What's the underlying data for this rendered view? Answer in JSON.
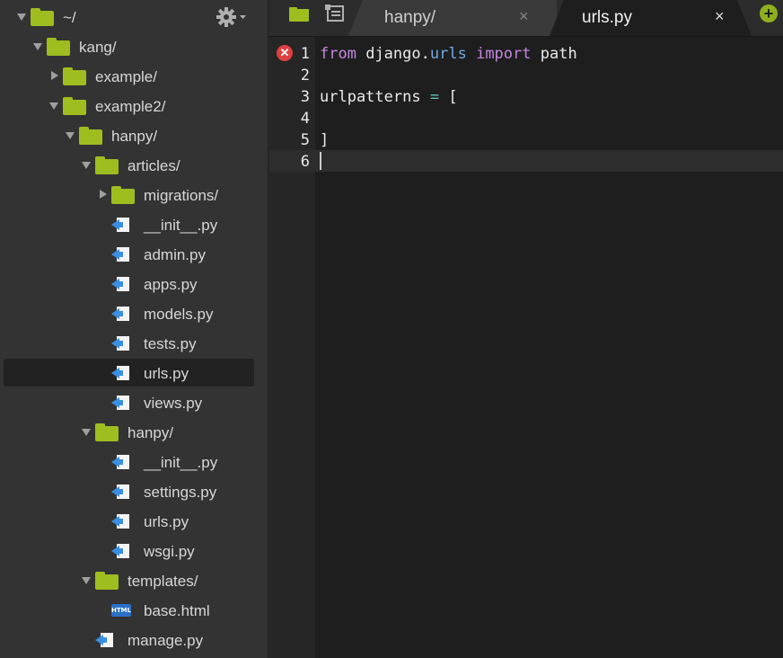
{
  "sidebar": {
    "root": "~/",
    "items": [
      {
        "label": "kang/",
        "type": "folder",
        "expanded": true,
        "depth": 1
      },
      {
        "label": "example/",
        "type": "folder",
        "expanded": false,
        "depth": 2
      },
      {
        "label": "example2/",
        "type": "folder",
        "expanded": true,
        "depth": 2
      },
      {
        "label": "hanpy/",
        "type": "folder",
        "expanded": true,
        "depth": 3
      },
      {
        "label": "articles/",
        "type": "folder",
        "expanded": true,
        "depth": 4
      },
      {
        "label": "migrations/",
        "type": "folder",
        "expanded": false,
        "depth": 5
      },
      {
        "label": "__init__.py",
        "type": "python",
        "depth": 5
      },
      {
        "label": "admin.py",
        "type": "python",
        "depth": 5
      },
      {
        "label": "apps.py",
        "type": "python",
        "depth": 5
      },
      {
        "label": "models.py",
        "type": "python",
        "depth": 5
      },
      {
        "label": "tests.py",
        "type": "python",
        "depth": 5
      },
      {
        "label": "urls.py",
        "type": "python",
        "depth": 5,
        "selected": true
      },
      {
        "label": "views.py",
        "type": "python",
        "depth": 5
      },
      {
        "label": "hanpy/",
        "type": "folder",
        "expanded": true,
        "depth": 4
      },
      {
        "label": "__init__.py",
        "type": "python",
        "depth": 5
      },
      {
        "label": "settings.py",
        "type": "python",
        "depth": 5
      },
      {
        "label": "urls.py",
        "type": "python",
        "depth": 5
      },
      {
        "label": "wsgi.py",
        "type": "python",
        "depth": 5
      },
      {
        "label": "templates/",
        "type": "folder",
        "expanded": true,
        "depth": 4
      },
      {
        "label": "base.html",
        "type": "html",
        "depth": 5
      },
      {
        "label": "manage.py",
        "type": "python",
        "depth": 4
      }
    ]
  },
  "tabs": [
    {
      "label": "hanpy/",
      "active": false
    },
    {
      "label": "urls.py",
      "active": true
    }
  ],
  "tab_close_glyph": "×",
  "new_tab_glyph": "+",
  "html_icon_text": "HTML",
  "editor": {
    "line_numbers": [
      "1",
      "2",
      "3",
      "4",
      "5",
      "6"
    ],
    "lines": {
      "l1_from": "from",
      "l1_django": "django",
      "l1_dot": ".",
      "l1_urls": "urls",
      "l1_import": "import",
      "l1_path": "path",
      "l3_name": "urlpatterns",
      "l3_eq": "=",
      "l3_bracket": "[",
      "l5_bracket": "]"
    },
    "active_line": 6,
    "error_line": 1
  },
  "colors": {
    "folder": "#9ebd1f",
    "keyword": "#c586e0",
    "module": "#6fa8e0",
    "error": "#e04040",
    "accent": "#8fb01d"
  }
}
